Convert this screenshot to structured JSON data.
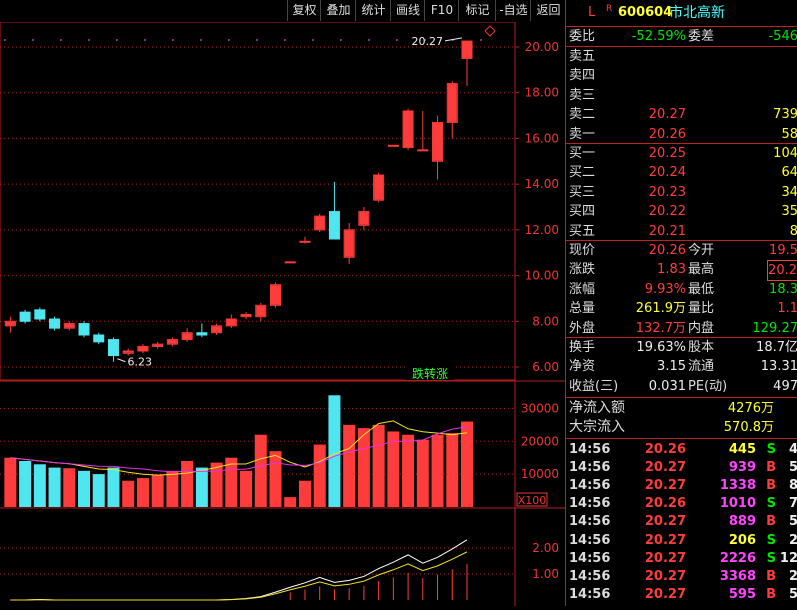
{
  "toolbar": {
    "buttons": [
      "复权",
      "叠加",
      "统计",
      "画线",
      "F10",
      "标记",
      "-自选",
      "返回"
    ]
  },
  "chart": {
    "price_labels": [
      "20.00",
      "18.00",
      "16.00",
      "14.00",
      "12.00",
      "10.00",
      "8.00",
      "6.00"
    ],
    "volume_labels": [
      "30000",
      "20000",
      "10000"
    ],
    "volume_unit": "X100",
    "indicator_labels": [
      "2.00",
      "1.00"
    ],
    "high_marker": "20.27",
    "low_marker": "6.23",
    "badge": "跌转涨",
    "colors": {
      "up": "#ff3c3c",
      "down": "#50e6f0",
      "grid": "#b21e1e",
      "ma_white": "#ffffff",
      "ma_yellow": "#f5e11e",
      "ma_magenta": "#e632e6"
    }
  },
  "stock": {
    "prefix": "L",
    "badge": "R",
    "code": "600604",
    "name": "市北高新"
  },
  "ratio": {
    "label": "委比",
    "value": "-52.59%",
    "diff_label": "委差",
    "diff_value": "-546"
  },
  "sell": [
    {
      "label": "卖五",
      "price": "",
      "vol": ""
    },
    {
      "label": "卖四",
      "price": "",
      "vol": ""
    },
    {
      "label": "卖三",
      "price": "",
      "vol": ""
    },
    {
      "label": "卖二",
      "price": "20.27",
      "vol": "739"
    },
    {
      "label": "卖一",
      "price": "20.26",
      "vol": "58"
    }
  ],
  "buy": [
    {
      "label": "买一",
      "price": "20.25",
      "vol": "104"
    },
    {
      "label": "买二",
      "price": "20.24",
      "vol": "64"
    },
    {
      "label": "买三",
      "price": "20.23",
      "vol": "34"
    },
    {
      "label": "买四",
      "price": "20.22",
      "vol": "35"
    },
    {
      "label": "买五",
      "price": "20.21",
      "vol": "8"
    }
  ],
  "quote": [
    {
      "l1": "现价",
      "v1": "20.26",
      "c1": "red",
      "l2": "今开",
      "v2": "19.5",
      "c2": "red"
    },
    {
      "l1": "涨跌",
      "v1": "1.83",
      "c1": "red",
      "l2": "最高",
      "v2": "20.2",
      "c2": "red"
    },
    {
      "l1": "涨幅",
      "v1": "9.93%",
      "c1": "red",
      "l2": "最低",
      "v2": "18.3",
      "c2": "green"
    },
    {
      "l1": "总量",
      "v1": "261.9万",
      "c1": "yellow",
      "l2": "量比",
      "v2": "1.1",
      "c2": "red"
    },
    {
      "l1": "外盘",
      "v1": "132.7万",
      "c1": "red",
      "l2": "内盘",
      "v2": "129.27",
      "c2": "green"
    }
  ],
  "fin": [
    {
      "l1": "换手",
      "v1": "19.63%",
      "l2": "股本",
      "v2": "18.7亿"
    },
    {
      "l1": "净资",
      "v1": "3.15",
      "l2": "流通",
      "v2": "13.31"
    },
    {
      "l1": "收益(三)",
      "v1": "0.031",
      "l2": "PE(动)",
      "v2": "497"
    }
  ],
  "flow": [
    {
      "label": "净流入额",
      "value": "4276万"
    },
    {
      "label": "大宗流入",
      "value": "570.8万"
    }
  ],
  "ticks": [
    {
      "time": "14:56",
      "price": "20.26",
      "vol": "445",
      "vc": "yellow",
      "side": "S",
      "extra": "4"
    },
    {
      "time": "14:56",
      "price": "20.27",
      "vol": "939",
      "vc": "magenta",
      "side": "B",
      "extra": "5"
    },
    {
      "time": "14:56",
      "price": "20.27",
      "vol": "1338",
      "vc": "magenta",
      "side": "B",
      "extra": "8"
    },
    {
      "time": "14:56",
      "price": "20.26",
      "vol": "1010",
      "vc": "magenta",
      "side": "S",
      "extra": "7"
    },
    {
      "time": "14:56",
      "price": "20.27",
      "vol": "889",
      "vc": "magenta",
      "side": "B",
      "extra": "5"
    },
    {
      "time": "14:56",
      "price": "20.27",
      "vol": "206",
      "vc": "yellow",
      "side": "S",
      "extra": "2"
    },
    {
      "time": "14:56",
      "price": "20.27",
      "vol": "2226",
      "vc": "magenta",
      "side": "S",
      "extra": "12"
    },
    {
      "time": "14:56",
      "price": "20.27",
      "vol": "3368",
      "vc": "magenta",
      "side": "B",
      "extra": "2"
    },
    {
      "time": "14:56",
      "price": "20.27",
      "vol": "595",
      "vc": "magenta",
      "side": "B",
      "extra": "5"
    }
  ],
  "chart_data": {
    "type": "candlestick",
    "price_axis": [
      6,
      20
    ],
    "candles": [
      {
        "o": 7.8,
        "c": 8.0,
        "h": 8.2,
        "l": 7.5,
        "v": 15000
      },
      {
        "o": 8.4,
        "c": 8.0,
        "h": 8.5,
        "l": 7.9,
        "v": 14000
      },
      {
        "o": 8.5,
        "c": 8.1,
        "h": 8.6,
        "l": 8.0,
        "v": 13000
      },
      {
        "o": 8.1,
        "c": 7.7,
        "h": 8.2,
        "l": 7.6,
        "v": 12000
      },
      {
        "o": 7.7,
        "c": 7.9,
        "h": 8.0,
        "l": 7.6,
        "v": 11800
      },
      {
        "o": 7.9,
        "c": 7.4,
        "h": 8.0,
        "l": 7.3,
        "v": 11000
      },
      {
        "o": 7.4,
        "c": 7.1,
        "h": 7.5,
        "l": 7.0,
        "v": 10000
      },
      {
        "o": 7.2,
        "c": 6.5,
        "h": 7.3,
        "l": 6.23,
        "v": 12000
      },
      {
        "o": 6.6,
        "c": 6.7,
        "h": 6.8,
        "l": 6.5,
        "v": 8000
      },
      {
        "o": 6.7,
        "c": 6.9,
        "h": 7.0,
        "l": 6.6,
        "v": 8800
      },
      {
        "o": 6.9,
        "c": 7.0,
        "h": 7.1,
        "l": 6.8,
        "v": 9800
      },
      {
        "o": 7.0,
        "c": 7.2,
        "h": 7.3,
        "l": 6.9,
        "v": 11000
      },
      {
        "o": 7.2,
        "c": 7.5,
        "h": 7.7,
        "l": 7.1,
        "v": 14000
      },
      {
        "o": 7.5,
        "c": 7.4,
        "h": 7.9,
        "l": 7.3,
        "v": 12000
      },
      {
        "o": 7.5,
        "c": 7.8,
        "h": 7.9,
        "l": 7.4,
        "v": 13500
      },
      {
        "o": 7.8,
        "c": 8.1,
        "h": 8.3,
        "l": 7.7,
        "v": 15000
      },
      {
        "o": 8.2,
        "c": 8.3,
        "h": 8.4,
        "l": 8.1,
        "v": 11000
      },
      {
        "o": 8.2,
        "c": 8.7,
        "h": 8.8,
        "l": 8.0,
        "v": 22000
      },
      {
        "o": 8.7,
        "c": 9.6,
        "h": 9.7,
        "l": 8.6,
        "v": 17000
      },
      {
        "o": 10.6,
        "c": 10.6,
        "h": 10.6,
        "l": 10.6,
        "v": 3000
      },
      {
        "o": 11.5,
        "c": 11.5,
        "h": 11.7,
        "l": 11.4,
        "v": 8000
      },
      {
        "o": 12.0,
        "c": 12.6,
        "h": 12.7,
        "l": 11.9,
        "v": 19000
      },
      {
        "o": 12.8,
        "c": 11.6,
        "h": 14.1,
        "l": 11.6,
        "v": 34000
      },
      {
        "o": 10.8,
        "c": 12.0,
        "h": 12.3,
        "l": 10.5,
        "v": 25000
      },
      {
        "o": 12.2,
        "c": 12.8,
        "h": 13.0,
        "l": 12.0,
        "v": 24000
      },
      {
        "o": 13.3,
        "c": 14.4,
        "h": 14.5,
        "l": 13.2,
        "v": 25000
      },
      {
        "o": 15.7,
        "c": 15.7,
        "h": 15.7,
        "l": 15.7,
        "v": 23000
      },
      {
        "o": 15.6,
        "c": 17.2,
        "h": 17.3,
        "l": 15.5,
        "v": 22000
      },
      {
        "o": 15.5,
        "c": 15.5,
        "h": 17.2,
        "l": 15.5,
        "v": 20500
      },
      {
        "o": 15.0,
        "c": 16.7,
        "h": 17.0,
        "l": 14.2,
        "v": 22000
      },
      {
        "o": 16.7,
        "c": 18.4,
        "h": 18.5,
        "l": 16.0,
        "v": 22500
      },
      {
        "o": 19.5,
        "c": 20.26,
        "h": 20.27,
        "l": 18.3,
        "v": 26000
      }
    ],
    "volume_axis": [
      0,
      35000
    ]
  }
}
